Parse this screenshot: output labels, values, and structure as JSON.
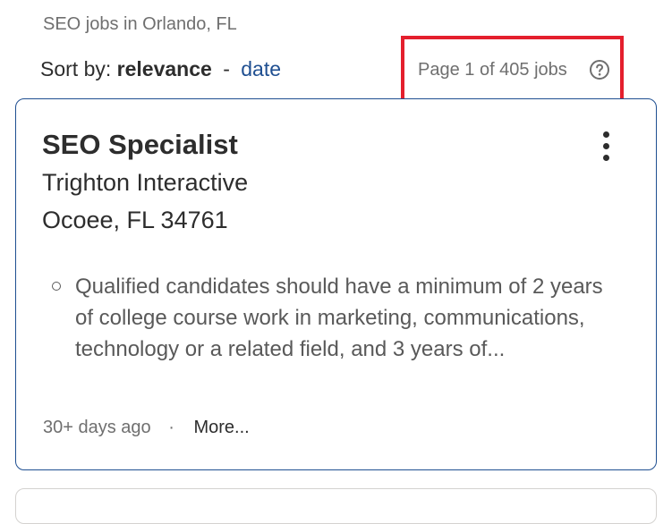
{
  "header": {
    "breadcrumb": "SEO jobs in Orlando, FL",
    "sort_label": "Sort by:",
    "sort_current": "relevance",
    "sort_separator": "-",
    "sort_alt": "date",
    "page_count": "Page 1 of 405 jobs",
    "help_icon": "question-circle-icon",
    "highlight_color": "#e41f2d"
  },
  "job": {
    "title": "SEO Specialist",
    "company": "Trighton Interactive",
    "location": "Ocoee, FL 34761",
    "snippet": "Qualified candidates should have a minimum of 2 years of college course work in marketing, communications, technology or a related field, and 3 years of...",
    "posted": "30+ days ago",
    "meta_separator": "·",
    "more_label": "More...",
    "menu_icon": "kebab-menu-icon"
  },
  "colors": {
    "link": "#1f4f91",
    "card_border": "#1f4f91",
    "text": "#2d2d2d",
    "muted": "#6f6f6f"
  }
}
